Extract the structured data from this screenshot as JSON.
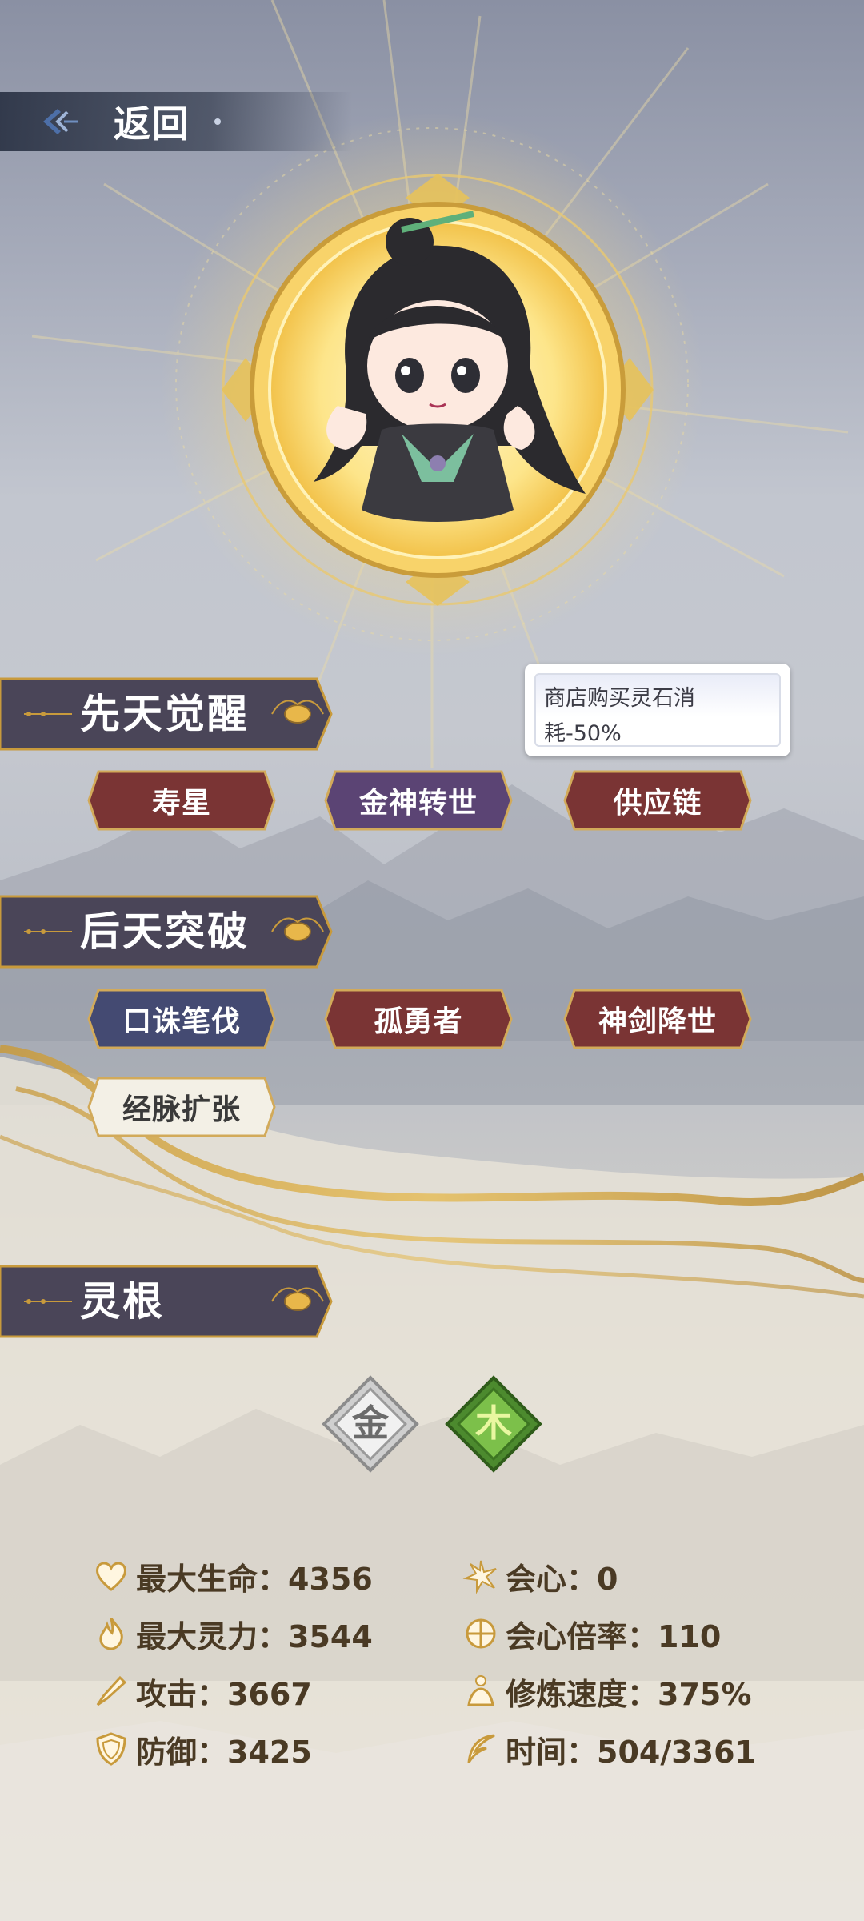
{
  "back": {
    "label": "返回"
  },
  "sections": {
    "innate": "先天觉醒",
    "acquired": "后天突破",
    "spirit_root": "灵根"
  },
  "innate_tags": [
    {
      "label": "寿星",
      "style": "red"
    },
    {
      "label": "金神转世",
      "style": "purple"
    },
    {
      "label": "供应链",
      "style": "red"
    }
  ],
  "acquired_tags": [
    {
      "label": "口诛笔伐",
      "style": "blue"
    },
    {
      "label": "孤勇者",
      "style": "red"
    },
    {
      "label": "神剑降世",
      "style": "red"
    },
    {
      "label": "经脉扩张",
      "style": "light"
    }
  ],
  "tooltip": {
    "text": "商店购买灵石消耗-50%"
  },
  "spirit_roots": [
    {
      "glyph": "金",
      "element": "metal",
      "color": "#d8d8d8"
    },
    {
      "glyph": "木",
      "element": "wood",
      "color": "#5fa03a"
    }
  ],
  "stats": {
    "max_hp": "最大生命：4356",
    "max_mana": "最大灵力：3544",
    "attack": "攻击：3667",
    "defense": "防御：3425",
    "crit": "会心：0",
    "crit_multiplier": "会心倍率：110",
    "cultivation_speed": "修炼速度：375%",
    "time": "时间：504/3361"
  },
  "colors": {
    "red_tag": "#7a3434",
    "purple_tag": "#5b4474",
    "blue_tag": "#444a72",
    "light_tag": "#f3f0e6",
    "banner": "#4a4558",
    "gold": "#d9a94a",
    "stat_text": "#4a3a24"
  }
}
